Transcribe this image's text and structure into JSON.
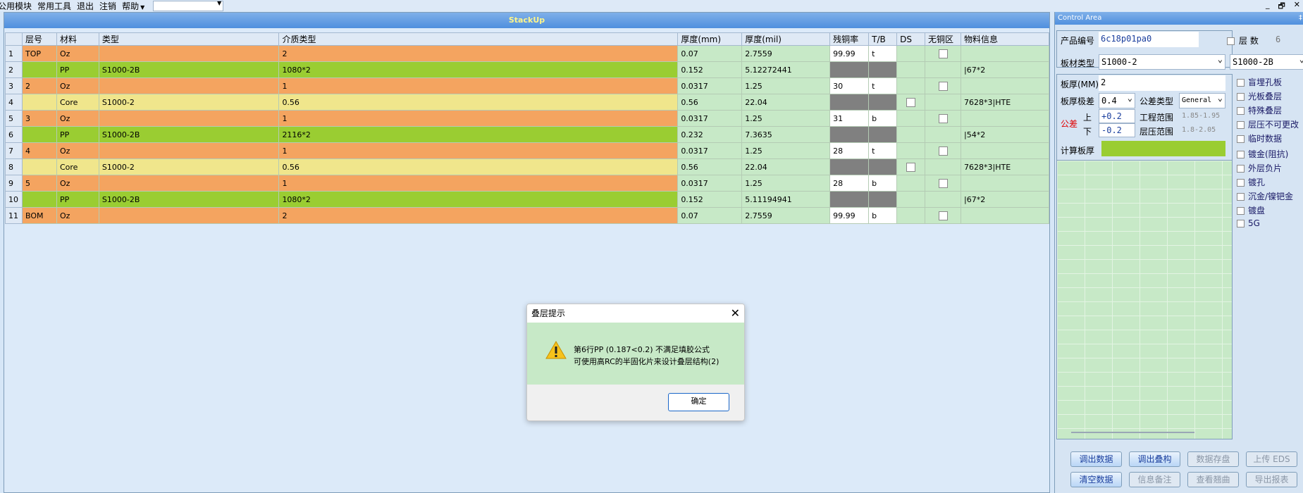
{
  "menu": {
    "items": [
      "公用模块",
      "常用工具",
      "退出",
      "注销",
      "帮助"
    ],
    "combo_value": ""
  },
  "window_controls": {
    "minimize": "_",
    "restore": "🗗",
    "close": "✕"
  },
  "stackup": {
    "title": "StackUp",
    "columns": [
      "层号",
      "材料",
      "类型",
      "介质类型",
      "厚度(mm)",
      "厚度(mil)",
      "残铜率",
      "T/B",
      "DS",
      "无铜区",
      "物料信息"
    ],
    "rows": [
      {
        "num": "1",
        "kind": "cu",
        "layer": "TOP",
        "material": "Oz",
        "type": "",
        "dielectric": "2",
        "mm": "0.07",
        "mil": "2.7559",
        "copper": "99.99",
        "tb": "t",
        "ds": "",
        "nocopper": true,
        "info": ""
      },
      {
        "num": "2",
        "kind": "pp",
        "layer": "",
        "material": "PP",
        "type": "S1000-2B",
        "dielectric": "1080*2",
        "mm": "0.152",
        "mil": "5.12272441",
        "copper": "",
        "tb": "",
        "ds": "",
        "nocopper": false,
        "info": "|67*2"
      },
      {
        "num": "3",
        "kind": "cu",
        "layer": "2",
        "material": "Oz",
        "type": "",
        "dielectric": "1",
        "mm": "0.0317",
        "mil": "1.25",
        "copper": "30",
        "tb": "t",
        "ds": "",
        "nocopper": true,
        "info": ""
      },
      {
        "num": "4",
        "kind": "core",
        "layer": "",
        "material": "Core",
        "type": "S1000-2",
        "dielectric": "0.56",
        "mm": "0.56",
        "mil": "22.04",
        "copper": "",
        "tb": "",
        "ds": "box",
        "nocopper": false,
        "info": "7628*3|HTE"
      },
      {
        "num": "5",
        "kind": "cu",
        "layer": "3",
        "material": "Oz",
        "type": "",
        "dielectric": "1",
        "mm": "0.0317",
        "mil": "1.25",
        "copper": "31",
        "tb": "b",
        "ds": "",
        "nocopper": true,
        "info": ""
      },
      {
        "num": "6",
        "kind": "pp",
        "layer": "",
        "material": "PP",
        "type": "S1000-2B",
        "dielectric": "2116*2",
        "mm": "0.232",
        "mil": "7.3635",
        "copper": "",
        "tb": "",
        "ds": "",
        "nocopper": false,
        "info": "|54*2"
      },
      {
        "num": "7",
        "kind": "cu",
        "layer": "4",
        "material": "Oz",
        "type": "",
        "dielectric": "1",
        "mm": "0.0317",
        "mil": "1.25",
        "copper": "28",
        "tb": "t",
        "ds": "",
        "nocopper": true,
        "info": ""
      },
      {
        "num": "8",
        "kind": "core",
        "layer": "",
        "material": "Core",
        "type": "S1000-2",
        "dielectric": "0.56",
        "mm": "0.56",
        "mil": "22.04",
        "copper": "",
        "tb": "",
        "ds": "box",
        "nocopper": false,
        "info": "7628*3|HTE"
      },
      {
        "num": "9",
        "kind": "cu",
        "layer": "5",
        "material": "Oz",
        "type": "",
        "dielectric": "1",
        "mm": "0.0317",
        "mil": "1.25",
        "copper": "28",
        "tb": "b",
        "ds": "",
        "nocopper": true,
        "info": ""
      },
      {
        "num": "10",
        "kind": "pp",
        "layer": "",
        "material": "PP",
        "type": "S1000-2B",
        "dielectric": "1080*2",
        "mm": "0.152",
        "mil": "5.11194941",
        "copper": "",
        "tb": "",
        "ds": "",
        "nocopper": false,
        "info": "|67*2"
      },
      {
        "num": "11",
        "kind": "cu",
        "layer": "BOM",
        "material": "Oz",
        "type": "",
        "dielectric": "2",
        "mm": "0.07",
        "mil": "2.7559",
        "copper": "99.99",
        "tb": "b",
        "ds": "",
        "nocopper": true,
        "info": ""
      }
    ]
  },
  "control": {
    "title": "Control Area",
    "pin": "‡",
    "product_label": "产品编号",
    "product_value": "6c18p01pa0",
    "layers_label": "层 数",
    "layers_value": "6",
    "board_type_label": "板材类型",
    "board_type_value": "S1000-2",
    "board_type_value2": "S1000-2B",
    "thickness_label": "板厚(MM)",
    "thickness_value": "2",
    "tol_grade_label": "板厚极差",
    "tol_grade_value": "0.4",
    "tol_type_label": "公差类型",
    "tol_type_value": "General",
    "tolerance_label": "公差",
    "upper_label": "上",
    "upper_value": "+0.2",
    "lower_label": "下",
    "lower_value": "-0.2",
    "eng_range_label": "工程范围",
    "eng_range_value": "1.85-1.95",
    "press_range_label": "层压范围",
    "press_range_value": "1.8-2.05",
    "calc_label": "计算板厚",
    "calc_value": "",
    "checks": [
      "盲埋孔板",
      "光板叠层",
      "特殊叠层",
      "层压不可更改",
      "临时数据",
      "镀金(阻抗)",
      "外层负片",
      "镀孔",
      "沉金/镍钯金",
      "镀盘",
      "5G"
    ],
    "buttons": [
      {
        "label": "调出数据",
        "enabled": true
      },
      {
        "label": "调出叠构",
        "enabled": true
      },
      {
        "label": "数据存盘",
        "enabled": false
      },
      {
        "label": "上传 EDS",
        "enabled": false
      },
      {
        "label": "清空数据",
        "enabled": true
      },
      {
        "label": "信息备注",
        "enabled": false
      },
      {
        "label": "查看翘曲",
        "enabled": false
      },
      {
        "label": "导出报表",
        "enabled": false
      }
    ]
  },
  "dialog": {
    "title": "叠层提示",
    "line1": "第6行PP (0.187<0.2) 不满足填胶公式",
    "line2": "可使用高RC的半固化片来设计叠层结构(2)",
    "ok": "确定",
    "close": "✕"
  },
  "colors": {
    "copper": "#f4a460",
    "pp": "#9acd32",
    "core": "#f0e68c",
    "cell_green": "#c7e9c7"
  }
}
